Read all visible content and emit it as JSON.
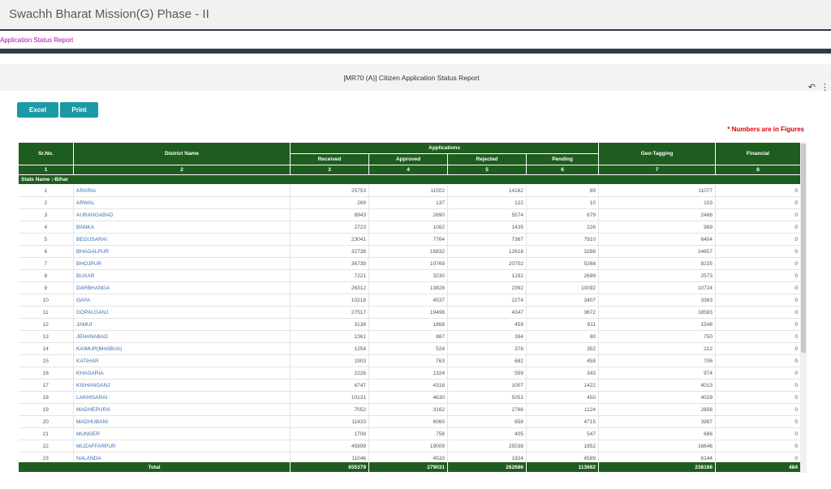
{
  "app": {
    "title": "Swachh Bharat Mission(G) Phase - II"
  },
  "breadcrumb": "Application Status Report",
  "report": {
    "title": "[MR70 (A)] Citizen Application Status Report"
  },
  "toolbar": {
    "excel_label": "Excel",
    "print_label": "Print",
    "undo_icon": "↶",
    "more_icon": "⋮"
  },
  "note": "* Numbers are in Figures",
  "table": {
    "headers": {
      "srno": "Sr.No.",
      "district": "District Name",
      "applications": "Applications",
      "received": "Received",
      "approved": "Approved",
      "rejected": "Rejected",
      "pending": "Pending",
      "geotag": "Geo-Tagging",
      "financial": "Financial"
    },
    "colnums": [
      "1",
      "2",
      "3",
      "4",
      "5",
      "6",
      "7",
      "8"
    ],
    "state_label": "State Name :-Bihar",
    "rows": [
      [
        "1",
        "ARARIA",
        "25753",
        "11502",
        "14162",
        "89",
        "11077",
        "0"
      ],
      [
        "2",
        "ARWAL",
        "269",
        "137",
        "122",
        "10",
        "103",
        "0"
      ],
      [
        "3",
        "AURANGABAD",
        "8943",
        "2690",
        "5574",
        "679",
        "2486",
        "0"
      ],
      [
        "4",
        "BANKA",
        "2723",
        "1062",
        "1435",
        "226",
        "969",
        "0"
      ],
      [
        "5",
        "BEGUSARAI",
        "23041",
        "7764",
        "7367",
        "7910",
        "6404",
        "0"
      ],
      [
        "6",
        "BHAGALPUR",
        "32738",
        "16832",
        "12618",
        "3288",
        "14657",
        "0"
      ],
      [
        "7",
        "BHOJPUR",
        "36739",
        "10769",
        "20702",
        "5268",
        "8235",
        "0"
      ],
      [
        "8",
        "BUXAR",
        "7221",
        "3230",
        "1292",
        "2699",
        "2573",
        "0"
      ],
      [
        "9",
        "DARBHANGA",
        "26312",
        "13828",
        "2392",
        "10092",
        "10724",
        "0"
      ],
      [
        "10",
        "GAYA",
        "10218",
        "4537",
        "2274",
        "3407",
        "3363",
        "0"
      ],
      [
        "11",
        "GOPALGANJ",
        "27517",
        "19498",
        "4347",
        "3672",
        "18593",
        "0"
      ],
      [
        "12",
        "JAMUI",
        "3138",
        "1868",
        "459",
        "811",
        "1548",
        "0"
      ],
      [
        "13",
        "JEHANABAD",
        "1361",
        "887",
        "394",
        "80",
        "750",
        "0"
      ],
      [
        "14",
        "KAIMUR(BHABUA)",
        "1254",
        "524",
        "378",
        "352",
        "212",
        "0"
      ],
      [
        "15",
        "KATIHAR",
        "1903",
        "763",
        "682",
        "458",
        "706",
        "0"
      ],
      [
        "16",
        "KHAGARIA",
        "2226",
        "1324",
        "559",
        "343",
        "974",
        "0"
      ],
      [
        "17",
        "KISHANGANJ",
        "6747",
        "4318",
        "1007",
        "1422",
        "4013",
        "0"
      ],
      [
        "18",
        "LAKHISARAI",
        "10131",
        "4630",
        "5051",
        "450",
        "4029",
        "0"
      ],
      [
        "19",
        "MADHEPURA",
        "7052",
        "3162",
        "2766",
        "1124",
        "2856",
        "0"
      ],
      [
        "20",
        "MADHUBANI",
        "11433",
        "6060",
        "658",
        "4715",
        "3987",
        "0"
      ],
      [
        "21",
        "MUNGER",
        "1708",
        "756",
        "405",
        "547",
        "686",
        "0"
      ],
      [
        "22",
        "MUZAFFARPUR",
        "45899",
        "19009",
        "25038",
        "1852",
        "16646",
        "0"
      ],
      [
        "23",
        "NALANDA",
        "11046",
        "4533",
        "1924",
        "4589",
        "6144",
        "0"
      ]
    ],
    "total": {
      "label": "Total",
      "received": "655379",
      "approved": "279031",
      "rejected": "262686",
      "pending": "113662",
      "geotag": "238168",
      "financial": "484"
    }
  }
}
